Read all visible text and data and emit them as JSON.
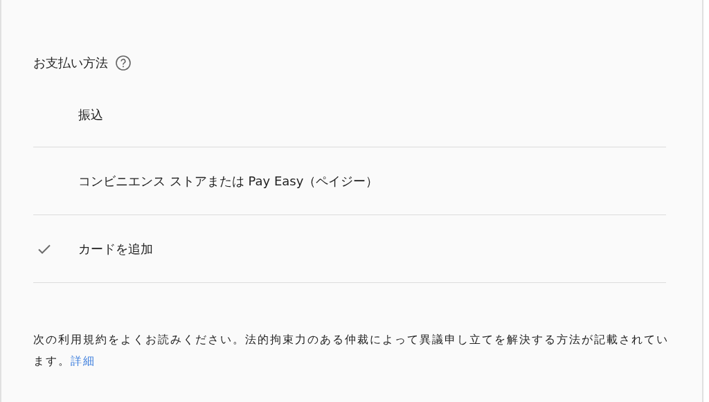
{
  "section": {
    "title": "お支払い方法"
  },
  "options": [
    {
      "label": "振込",
      "selected": false
    },
    {
      "label": "コンビニエンス ストアまたは Pay Easy（ペイジー）",
      "selected": false
    },
    {
      "label": "カードを追加",
      "selected": true
    }
  ],
  "notice": {
    "text": "次の利用規約をよくお読みください。法的拘束力のある仲裁によって異議申し立てを解決する方法が記載されています。",
    "link": "詳細"
  }
}
